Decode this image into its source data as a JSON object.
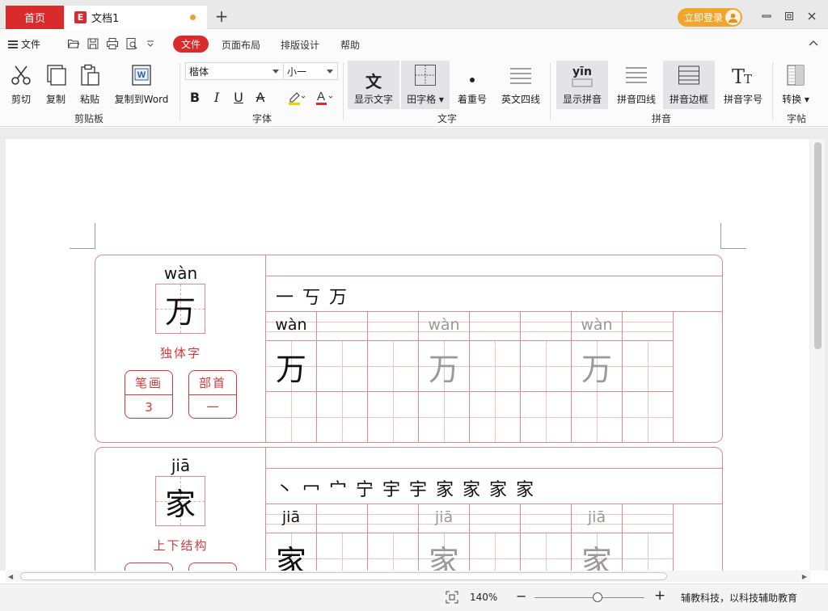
{
  "titlebar": {
    "home_tab": "首页",
    "doc_tab": "文档1",
    "doc_logo": "E",
    "login_label": "立即登录"
  },
  "menubar": {
    "file_label": "文件",
    "tabs": [
      "文件",
      "页面布局",
      "排版设计",
      "帮助"
    ]
  },
  "ribbon": {
    "clipboard": {
      "group": "剪贴板",
      "cut": "剪切",
      "copy": "复制",
      "paste": "粘贴",
      "copy_word": "复制到Word"
    },
    "font": {
      "group": "字体",
      "family": "楷体",
      "size": "小一",
      "bold": "B",
      "italic": "I",
      "underline": "U",
      "strike": "A",
      "font_color": "A"
    },
    "text": {
      "group": "文字",
      "show_text": "显示文字",
      "tian_grid": "田字格",
      "emphasis": "着重号",
      "english_lines": "英文四线"
    },
    "pinyin": {
      "group": "拼音",
      "show_pinyin": "显示拼音",
      "show_pinyin_icon": "yīn",
      "pinyin_lines": "拼音四线",
      "pinyin_border": "拼音边框",
      "pinyin_size": "拼音字号"
    },
    "copybook": {
      "group": "字帖",
      "convert": "转换"
    }
  },
  "cards": [
    {
      "pinyin": "wàn",
      "char": "万",
      "structure": "独体字",
      "strokes_label": "笔画",
      "strokes_value": "3",
      "radical_label": "部首",
      "radical_value": "一",
      "stroke_order": "一 丂 万",
      "practice": [
        {
          "pinyin": "wàn",
          "char": "万",
          "shade": "solid"
        },
        {
          "pinyin": "wàn",
          "char": "万",
          "shade": "trace"
        },
        {
          "pinyin": "wàn",
          "char": "万",
          "shade": "trace"
        }
      ]
    },
    {
      "pinyin": "jiā",
      "char": "家",
      "structure": "上下结构",
      "strokes_label": "",
      "strokes_value": "",
      "radical_label": "",
      "radical_value": "",
      "stroke_order": "丶 冖 宀 宁 宇 宇 家 家 家 家",
      "practice": [
        {
          "pinyin": "jiā",
          "char": "家",
          "shade": "solid"
        },
        {
          "pinyin": "jiā",
          "char": "家",
          "shade": "trace"
        },
        {
          "pinyin": "jiā",
          "char": "家",
          "shade": "trace"
        }
      ]
    }
  ],
  "statusbar": {
    "zoom": "140%",
    "zoom_minus": "−",
    "zoom_plus": "+",
    "slider_fraction": 0.57,
    "company": "辅教科技，以科技辅助教育"
  },
  "colors": {
    "accent": "#d92b2b",
    "login": "#f0a52b",
    "grid_line": "#e08a8a"
  }
}
